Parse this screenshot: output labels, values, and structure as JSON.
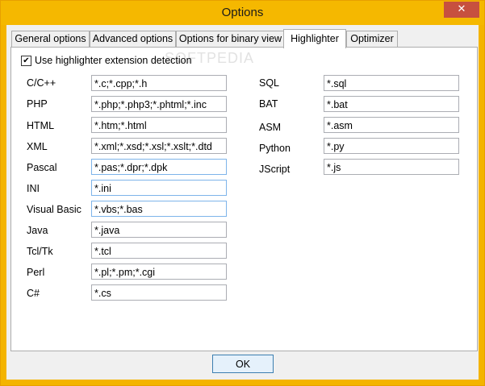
{
  "window": {
    "title": "Options",
    "close_glyph": "✕"
  },
  "tabs": [
    {
      "label": "General options"
    },
    {
      "label": "Advanced options"
    },
    {
      "label": "Options for binary view"
    },
    {
      "label": "Highlighter",
      "active": true
    },
    {
      "label": "Optimizer"
    }
  ],
  "highlighter": {
    "checkbox_label": "Use highlighter extension detection",
    "checkbox_checked": true,
    "checkbox_glyph": "✔",
    "watermark": "SOFTPEDIA",
    "left": [
      {
        "label": "C/C++",
        "value": "*.c;*.cpp;*.h"
      },
      {
        "label": "PHP",
        "value": "*.php;*.php3;*.phtml;*.inc"
      },
      {
        "label": "HTML",
        "value": "*.htm;*.html"
      },
      {
        "label": "XML",
        "value": "*.xml;*.xsd;*.xsl;*.xslt;*.dtd"
      },
      {
        "label": "Pascal",
        "value": "*.pas;*.dpr;*.dpk"
      },
      {
        "label": "INI",
        "value": "*.ini"
      },
      {
        "label": "Visual Basic",
        "value": "*.vbs;*.bas"
      },
      {
        "label": "Java",
        "value": "*.java"
      },
      {
        "label": "Tcl/Tk",
        "value": "*.tcl"
      },
      {
        "label": "Perl",
        "value": "*.pl;*.pm;*.cgi"
      },
      {
        "label": "C#",
        "value": "*.cs"
      }
    ],
    "right": [
      {
        "label": "SQL",
        "value": "*.sql"
      },
      {
        "label": "BAT",
        "value": "*.bat"
      },
      {
        "label": "ASM",
        "value": "*.asm"
      },
      {
        "label": "Python",
        "value": "*.py"
      },
      {
        "label": "JScript",
        "value": "*.js"
      }
    ]
  },
  "footer": {
    "ok_label": "OK"
  }
}
